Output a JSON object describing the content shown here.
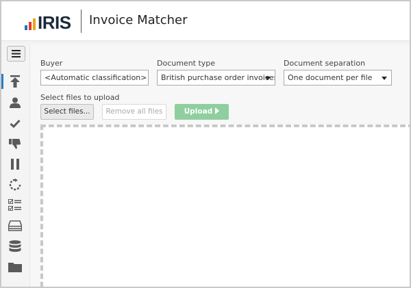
{
  "header": {
    "logo_text": "IRIS",
    "app_title": "Invoice Matcher"
  },
  "sidebar": {
    "menu_icon": "hamburger-icon",
    "items": [
      {
        "icon": "upload-icon",
        "active": true
      },
      {
        "icon": "user-icon",
        "active": false
      },
      {
        "icon": "checkmark-icon",
        "active": false
      },
      {
        "icon": "thumbs-down-icon",
        "active": false
      },
      {
        "icon": "pause-icon",
        "active": false
      },
      {
        "icon": "refresh-icon",
        "active": false
      },
      {
        "icon": "checklist-icon",
        "active": false
      },
      {
        "icon": "inbox-icon",
        "active": false
      },
      {
        "icon": "database-icon",
        "active": false
      },
      {
        "icon": "folder-icon",
        "active": false
      }
    ]
  },
  "form": {
    "buyer": {
      "label": "Buyer",
      "value": "<Automatic classification>"
    },
    "document_type": {
      "label": "Document type",
      "value": "British purchase order invoices"
    },
    "document_separation": {
      "label": "Document separation",
      "value": "One document per file"
    },
    "upload_label": "Select files to upload",
    "select_files_label": "Select files...",
    "remove_all_label": "Remove all files",
    "upload_button_label": "Upload"
  },
  "colors": {
    "accent": "#2a7cc7",
    "upload_button": "#8fcf9f",
    "logo_blue": "#2a6fb0",
    "logo_red": "#e23b2a",
    "logo_orange": "#f0a21c"
  }
}
